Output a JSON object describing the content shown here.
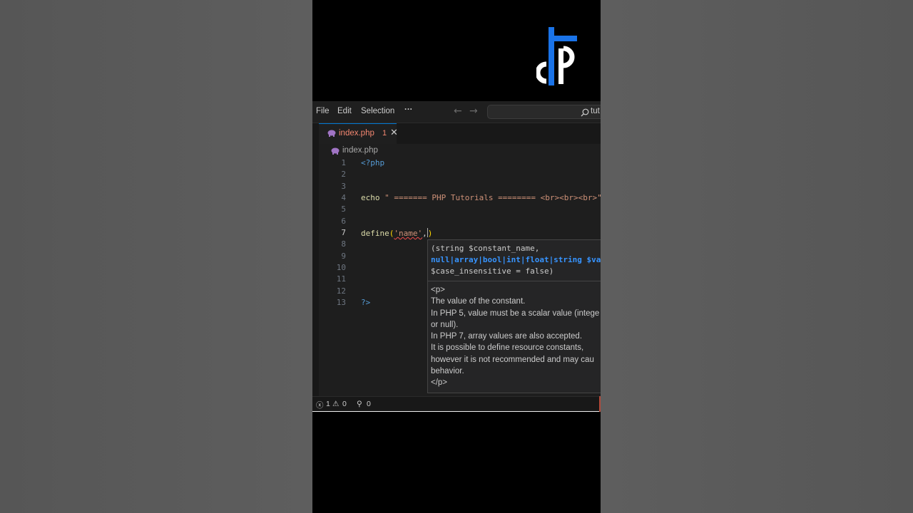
{
  "menu": {
    "file": "File",
    "edit": "Edit",
    "selection": "Selection",
    "more": "···"
  },
  "search": {
    "text": "tut"
  },
  "tab": {
    "name": "index.php",
    "problem_count": "1",
    "close": "✕"
  },
  "breadcrumb": {
    "file": "index.php"
  },
  "editor": {
    "line_numbers": [
      "1",
      "2",
      "3",
      "4",
      "5",
      "6",
      "7",
      "8",
      "9",
      "10",
      "11",
      "12",
      "13"
    ],
    "line1": "<?php",
    "line4_kw": "echo",
    "line4_str": " \" ======= PHP Tutorials ======== <br><br><br>\"",
    "line7_fn": "define",
    "line7_open": "(",
    "line7_str": "'name'",
    "line7_comma": ",",
    "line7_close": ")",
    "line13": "?>"
  },
  "hover": {
    "sig1": "(string $constant_name,",
    "sig2": "null|array|bool|int|float|string $va",
    "sig3": "$case_insensitive = false)",
    "doc": "<p>\nThe value of the constant.\nIn PHP 5, value must be a scalar value (intege\nor null).\nIn PHP 7, array values are also accepted.\nIt is possible to define resource constants,\nhowever it is not recommended and may cau\nbehavior.\n</p>"
  },
  "status": {
    "errors": "1",
    "warnings": "0",
    "ports": "0"
  },
  "colors": {
    "accent": "#0078d4",
    "error": "#f48771",
    "logo_blue": "#1a73e8"
  },
  "icons": [
    "php-elephant-icon",
    "close-icon",
    "search-icon",
    "arrow-left-icon",
    "arrow-right-icon",
    "error-icon",
    "warning-icon",
    "broadcast-icon",
    "logo-icon"
  ]
}
